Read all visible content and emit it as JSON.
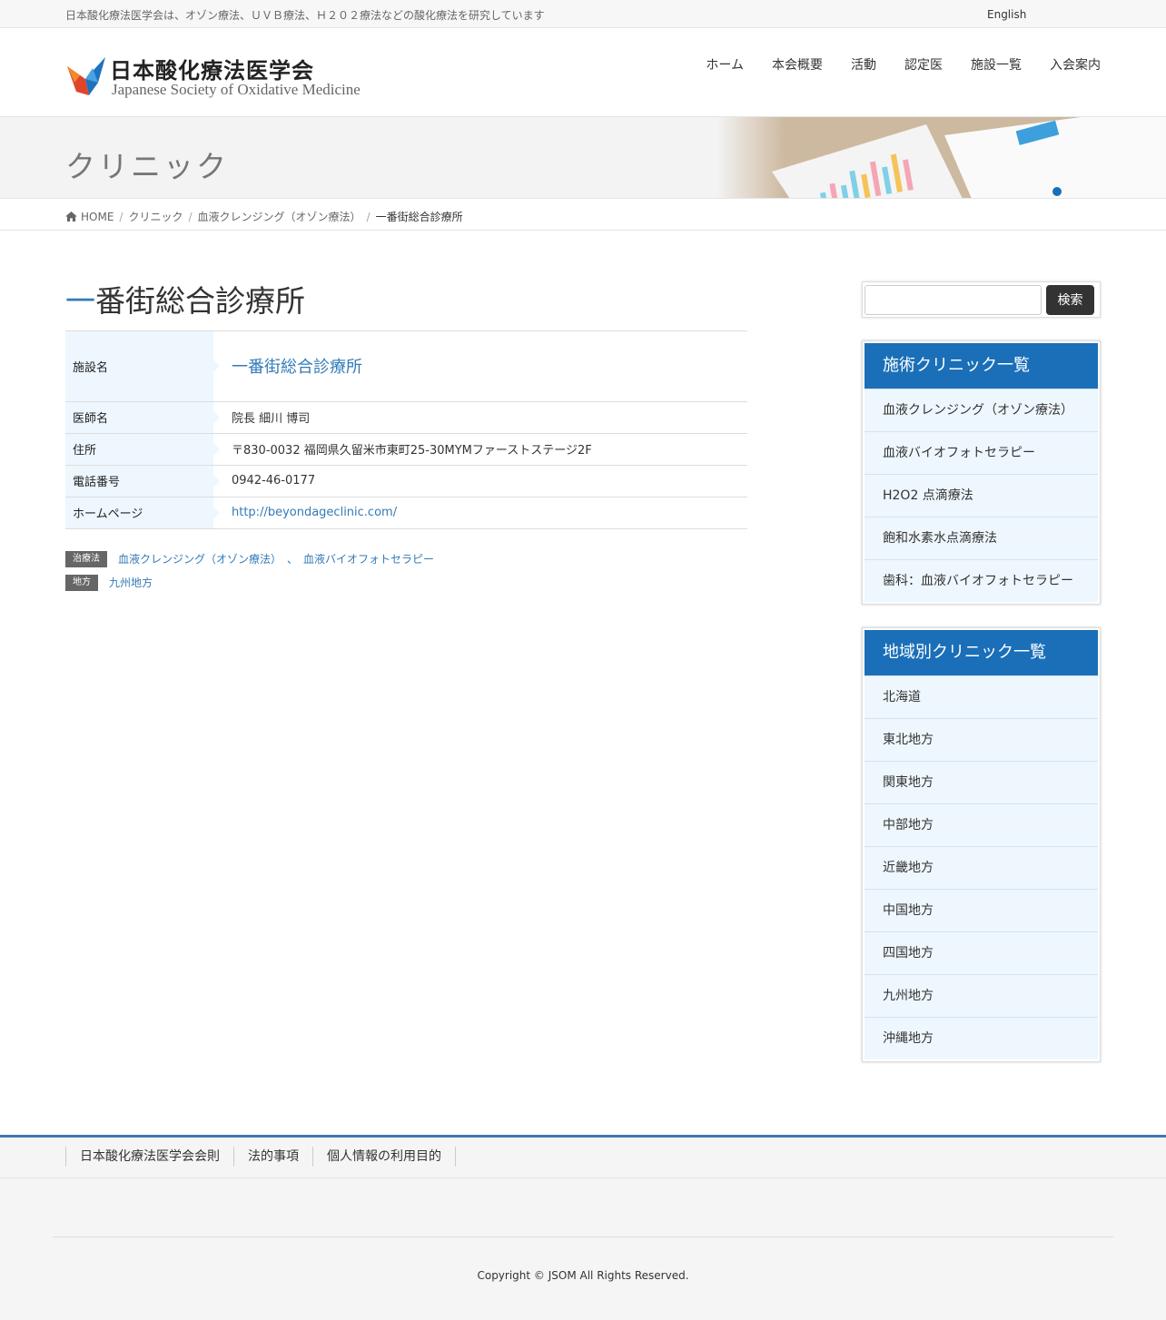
{
  "topbar": {
    "description": "日本酸化療法医学会は、オゾン療法、ＵＶＢ療法、Ｈ２０２療法などの酸化療法を研究しています",
    "language_link": "English"
  },
  "header": {
    "logo_jp": "日本酸化療法医学会",
    "logo_en": "Japanese Society of Oxidative Medicine",
    "nav": [
      "ホーム",
      "本会概要",
      "活動",
      "認定医",
      "施設一覧",
      "入会案内"
    ]
  },
  "page_title": "クリニック",
  "breadcrumb": {
    "home": "HOME",
    "items": [
      "クリニック",
      "血液クレンジング（オゾン療法）"
    ],
    "current": "一番街総合診療所"
  },
  "entry": {
    "title_first": "一",
    "title_rest": "番街総合診療所",
    "rows": [
      {
        "label": "施設名",
        "value": "一番街総合診療所"
      },
      {
        "label": "医師名",
        "value": "院長 細川 博司"
      },
      {
        "label": "住所",
        "value": "〒830-0032 福岡県久留米市東町25-30MYMファーストステージ2F"
      },
      {
        "label": "電話番号",
        "value": "0942-46-0177"
      },
      {
        "label": "ホームページ",
        "value": "http://beyondageclinic.com/"
      }
    ],
    "taxonomies": {
      "therapy_label": "治療法",
      "therapy_links": [
        "血液クレンジング（オゾン療法）",
        "血液バイオフォトセラピー"
      ],
      "separator": "、",
      "region_label": "地方",
      "region_link": "九州地方"
    }
  },
  "sidebar": {
    "search_button": "検索",
    "search_value": "",
    "treatment_widget": {
      "title": "施術クリニック一覧",
      "items": [
        "血液クレンジング（オゾン療法）",
        "血液バイオフォトセラピー",
        "H2O2 点滴療法",
        "飽和水素水点滴療法",
        "歯科：血液バイオフォトセラピー"
      ]
    },
    "region_widget": {
      "title": "地域別クリニック一覧",
      "items": [
        "北海道",
        "東北地方",
        "関東地方",
        "中部地方",
        "近畿地方",
        "中国地方",
        "四国地方",
        "九州地方",
        "沖縄地方"
      ]
    }
  },
  "footer": {
    "links": [
      "日本酸化療法医学会会則",
      "法的事項",
      "個人情報の利用目的"
    ],
    "copyright": "Copyright © JSOM All Rights Reserved."
  },
  "colors": {
    "accent": "#337ab7",
    "widget_header": "#1a6fb8",
    "table_label_bg": "#eef7fe",
    "footer_border": "#3c78b4"
  }
}
